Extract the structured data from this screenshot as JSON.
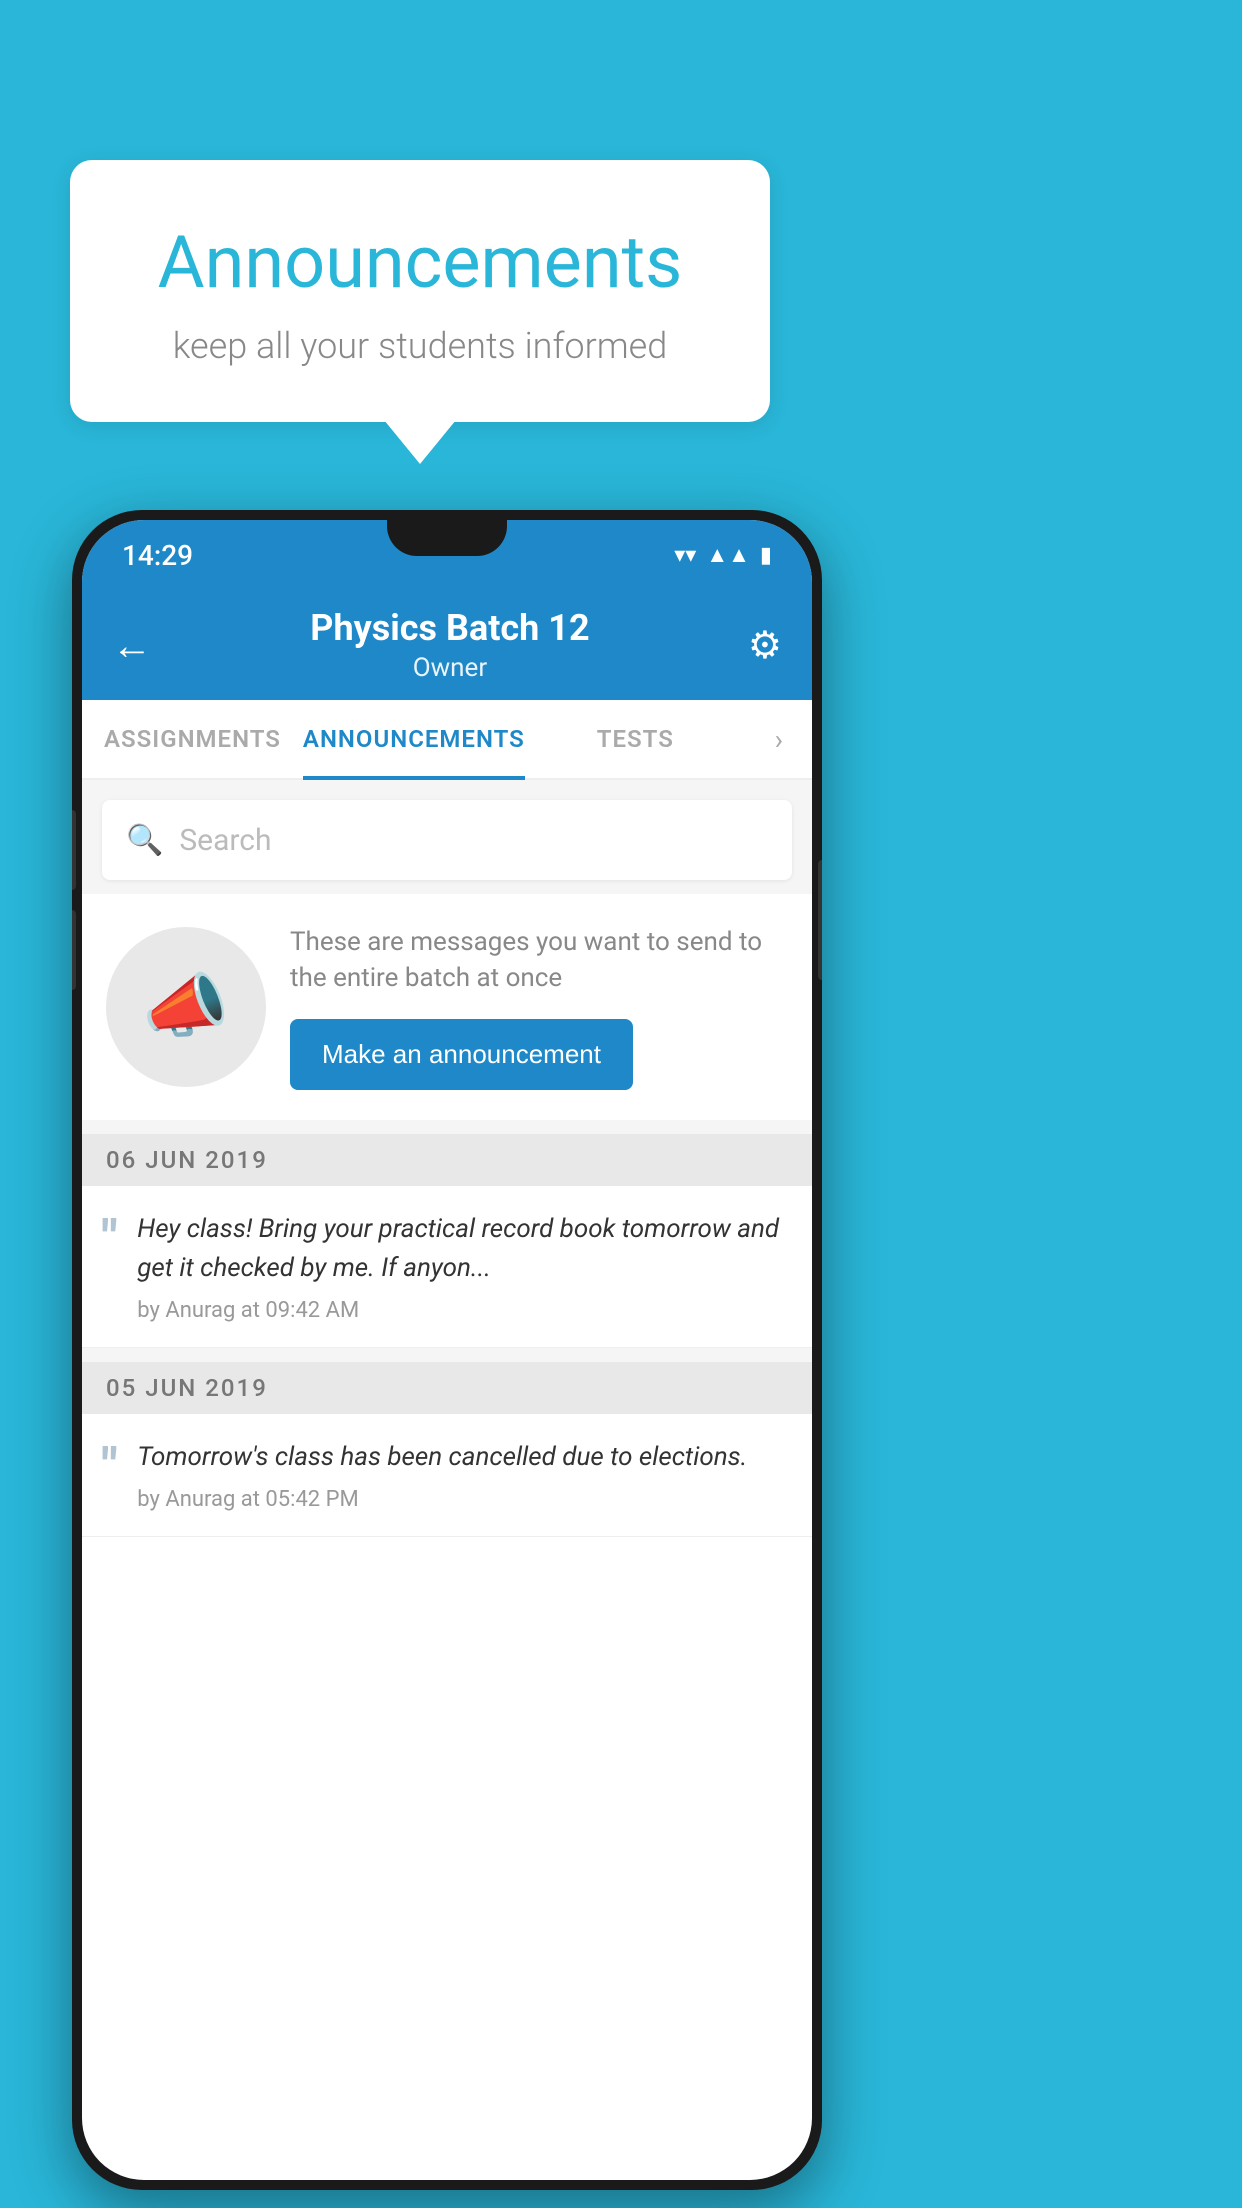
{
  "bubble": {
    "title": "Announcements",
    "subtitle": "keep all your students informed"
  },
  "phone": {
    "statusBar": {
      "time": "14:29",
      "wifiIcon": "▲",
      "signalIcon": "▲",
      "batteryIcon": "▮"
    },
    "header": {
      "title": "Physics Batch 12",
      "subtitle": "Owner",
      "backLabel": "←",
      "gearLabel": "⚙"
    },
    "tabs": [
      {
        "label": "ASSIGNMENTS",
        "active": false
      },
      {
        "label": "ANNOUNCEMENTS",
        "active": true
      },
      {
        "label": "TESTS",
        "active": false
      }
    ],
    "searchPlaceholder": "Search",
    "promo": {
      "message": "These are messages you want to send to the entire batch at once",
      "buttonLabel": "Make an announcement"
    },
    "announcements": [
      {
        "date": "06  JUN  2019",
        "message": "Hey class! Bring your practical record book tomorrow and get it checked by me. If anyon...",
        "meta": "by Anurag at 09:42 AM"
      },
      {
        "date": "05  JUN  2019",
        "message": "Tomorrow's class has been cancelled due to elections.",
        "meta": "by Anurag at 05:42 PM"
      }
    ]
  },
  "colors": {
    "primary": "#29b6d8",
    "appBlue": "#1e88c8",
    "white": "#ffffff"
  }
}
